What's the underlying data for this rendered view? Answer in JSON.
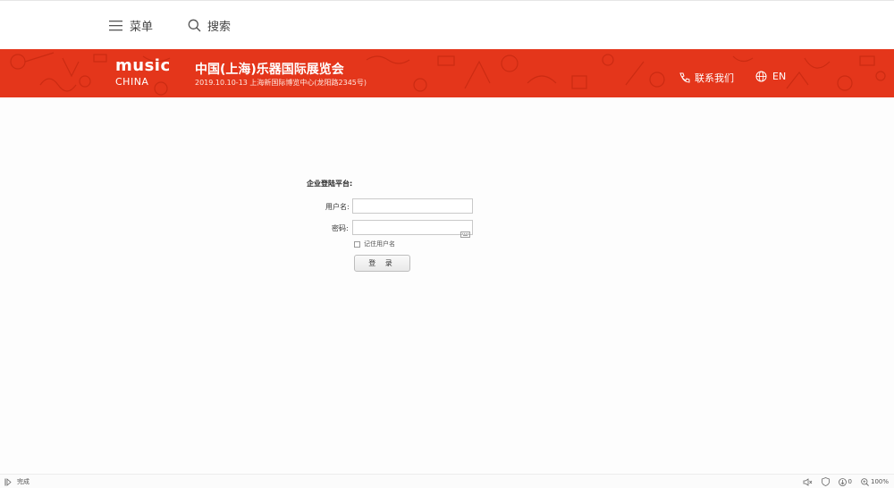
{
  "topbar": {
    "menu_label": "菜单",
    "search_label": "搜索"
  },
  "banner": {
    "logo_music": "music",
    "logo_china": "CHINA",
    "title": "中国(上海)乐器国际展览会",
    "subtitle": "2019.10.10-13 上海新国际博览中心(龙阳路2345号)",
    "contact_label": "联系我们",
    "lang_label": "EN",
    "colors": {
      "banner_red": "#e4361b",
      "pattern_red": "#c92a12"
    }
  },
  "login": {
    "heading": "企业登陆平台:",
    "username_label": "用户名:",
    "username_value": "",
    "password_label": "密码:",
    "password_value": "",
    "remember_label": "记住用户名",
    "login_button": "登 录"
  },
  "statusbar": {
    "status_text": "完成",
    "download_count": "0",
    "zoom": "100%"
  }
}
